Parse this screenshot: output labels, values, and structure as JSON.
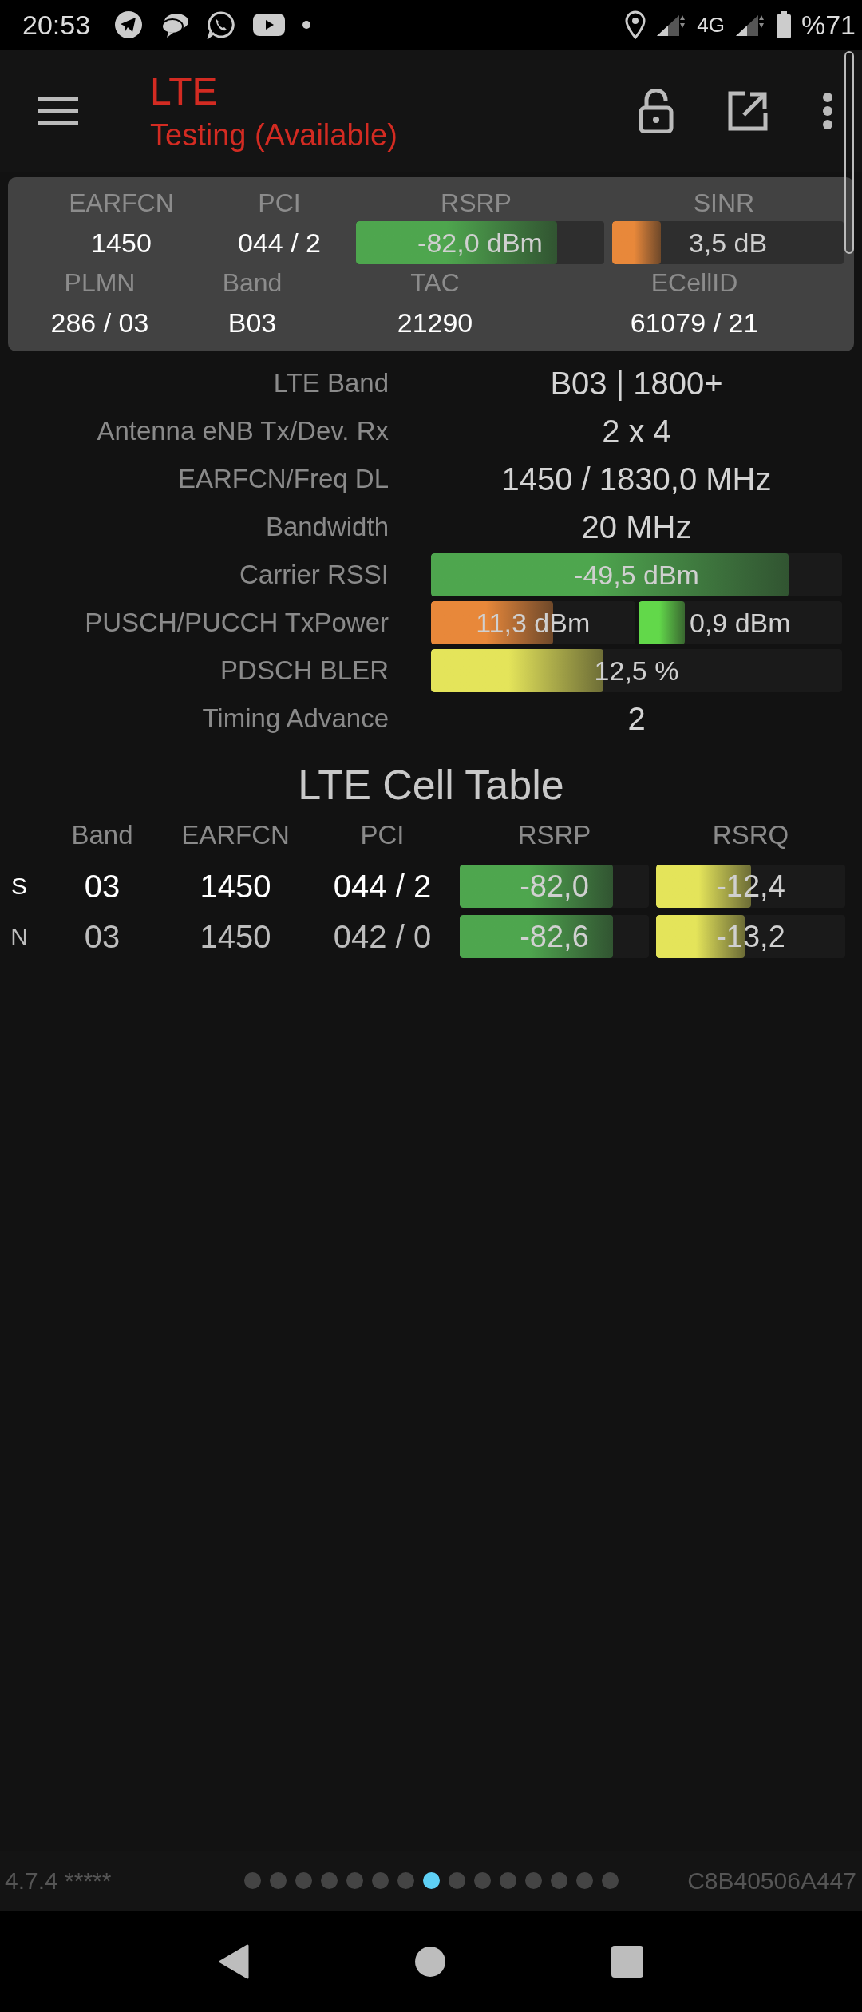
{
  "status_bar": {
    "time": "20:53",
    "network": "4G",
    "battery": "%71"
  },
  "toolbar": {
    "title": "LTE",
    "subtitle": "Testing (Available)"
  },
  "summary": {
    "row1": [
      {
        "kind": "text",
        "label": "EARFCN",
        "value": "1450"
      },
      {
        "kind": "text",
        "label": "PCI",
        "value": "044 / 2"
      },
      {
        "kind": "meter",
        "label": "RSRP",
        "value": "-82,0 dBm",
        "level": 0.81,
        "color": "#4ea64e"
      },
      {
        "kind": "meter",
        "label": "SINR",
        "value": "3,5 dB",
        "level": 0.21,
        "color": "#e8883a"
      }
    ],
    "row2": [
      {
        "kind": "text",
        "label": "PLMN",
        "value": "286 / 03"
      },
      {
        "kind": "text",
        "label": "Band",
        "value": "B03"
      },
      {
        "kind": "text",
        "label": "TAC",
        "value": "21290"
      },
      {
        "kind": "text",
        "label": "ECellID",
        "value": "61079 / 21"
      }
    ]
  },
  "details": [
    {
      "kind": "text",
      "label": "LTE Band",
      "value": "B03 | 1800+"
    },
    {
      "kind": "text",
      "label": "Antenna eNB Tx/Dev. Rx",
      "value": "2 x 4"
    },
    {
      "kind": "text",
      "label": "EARFCN/Freq DL",
      "value": "1450 / 1830,0 MHz"
    },
    {
      "kind": "text",
      "label": "Bandwidth",
      "value": "20 MHz"
    },
    {
      "kind": "meter",
      "label": "Carrier RSSI",
      "meters": [
        {
          "value": "-49,5 dBm",
          "level": 0.87,
          "color": "#4ea64e"
        }
      ]
    },
    {
      "kind": "meter",
      "label": "PUSCH/PUCCH TxPower",
      "meters": [
        {
          "value": "11,3 dBm",
          "level": 0.6,
          "color": "#e8883a"
        },
        {
          "value": "0,9 dBm",
          "level": 0.23,
          "color": "#62d84a"
        }
      ]
    },
    {
      "kind": "meter",
      "label": "PDSCH BLER",
      "meters": [
        {
          "value": "12,5 %",
          "level": 0.42,
          "color": "#e4e45a"
        }
      ]
    },
    {
      "kind": "text",
      "label": "Timing Advance",
      "value": "2"
    }
  ],
  "cell_table": {
    "title": "LTE Cell Table",
    "columns": [
      "Band",
      "EARFCN",
      "PCI",
      "RSRP",
      "RSRQ"
    ],
    "rows": [
      {
        "type": "S",
        "serving": true,
        "band": "03",
        "earfcn": "1450",
        "pci": "044 / 2",
        "rsrp": {
          "value": "-82,0",
          "level": 0.81,
          "color": "#4ea64e"
        },
        "rsrq": {
          "value": "-12,4",
          "level": 0.5,
          "color": "#e4e45a"
        }
      },
      {
        "type": "N",
        "serving": false,
        "band": "03",
        "earfcn": "1450",
        "pci": "042 / 0",
        "rsrp": {
          "value": "-82,6",
          "level": 0.81,
          "color": "#4ea64e"
        },
        "rsrq": {
          "value": "-13,2",
          "level": 0.47,
          "color": "#e4e45a"
        }
      }
    ]
  },
  "footer": {
    "version": "4.7.4 *****",
    "pages": [
      {
        "selected": false
      },
      {
        "selected": false
      },
      {
        "selected": false
      },
      {
        "selected": false
      },
      {
        "selected": false
      },
      {
        "selected": false
      },
      {
        "selected": false
      },
      {
        "selected": true
      },
      {
        "selected": false
      },
      {
        "selected": false
      },
      {
        "selected": false
      },
      {
        "selected": false
      },
      {
        "selected": false
      },
      {
        "selected": false
      },
      {
        "selected": false
      }
    ],
    "device_id": "C8B40506A447"
  }
}
